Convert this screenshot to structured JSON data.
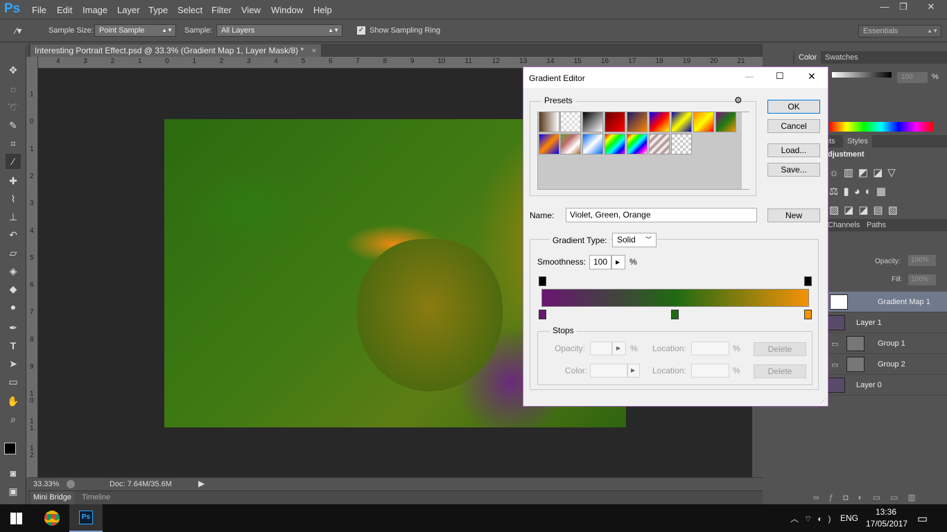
{
  "app": {
    "logo": "Ps",
    "menus": [
      "File",
      "Edit",
      "Image",
      "Layer",
      "Type",
      "Select",
      "Filter",
      "View",
      "Window",
      "Help"
    ]
  },
  "options": {
    "sample_size_label": "Sample Size:",
    "sample_size_value": "Point Sample",
    "sample_label": "Sample:",
    "sample_value": "All Layers",
    "show_ring_label": "Show Sampling Ring",
    "workspace": "Essentials"
  },
  "document": {
    "tab_title": "Interesting Portrait Effect.psd @ 33.3% (Gradient Map 1, Layer Mask/8) *",
    "close": "×"
  },
  "ruler": {
    "h": [
      "4",
      "3",
      "2",
      "1",
      "0",
      "1",
      "2",
      "3",
      "4",
      "5",
      "6",
      "7",
      "8",
      "9",
      "10",
      "11",
      "12",
      "13",
      "14",
      "15",
      "16",
      "17",
      "18",
      "19",
      "20",
      "21"
    ],
    "v": [
      "1",
      "0",
      "1",
      "2",
      "3",
      "4",
      "5",
      "6",
      "7",
      "8",
      "9",
      "1 0",
      "1 1",
      "1 2"
    ]
  },
  "status": {
    "zoom": "33.33%",
    "doc": "Doc: 7.64M/35.6M"
  },
  "bottom_tabs": [
    "Mini Bridge",
    "Timeline"
  ],
  "right_panel": {
    "color_tabs": [
      "Color",
      "Swatches"
    ],
    "opacity_value": "100",
    "percent": "%",
    "adj_tabs": [
      "nts",
      "Styles"
    ],
    "adj_title": "djustment",
    "layer_tabs": [
      "Channels",
      "Paths"
    ],
    "opacity_label": "Opacity:",
    "opacity": "100%",
    "fill_label": "Fill:",
    "fill": "100%",
    "layers": [
      "Gradient Map 1",
      "Layer 1",
      "Group 1",
      "Group 2",
      "Layer 0"
    ]
  },
  "dialog": {
    "title": "Gradient Editor",
    "presets_label": "Presets",
    "buttons": {
      "ok": "OK",
      "cancel": "Cancel",
      "load": "Load...",
      "save": "Save...",
      "new": "New"
    },
    "name_label": "Name:",
    "name_value": "Violet, Green, Orange",
    "type_label": "Gradient Type:",
    "type_value": "Solid",
    "smooth_label": "Smoothness:",
    "smooth_value": "100",
    "smooth_unit": "%",
    "stops_label": "Stops",
    "opacity_label": "Opacity:",
    "color_label": "Color:",
    "location_label": "Location:",
    "pct": "%",
    "delete": "Delete",
    "gradient_colors": [
      "#6b1574",
      "#1f6a12",
      "#f39208"
    ]
  },
  "taskbar": {
    "lang": "ENG",
    "time": "13:36",
    "date": "17/05/2017"
  }
}
